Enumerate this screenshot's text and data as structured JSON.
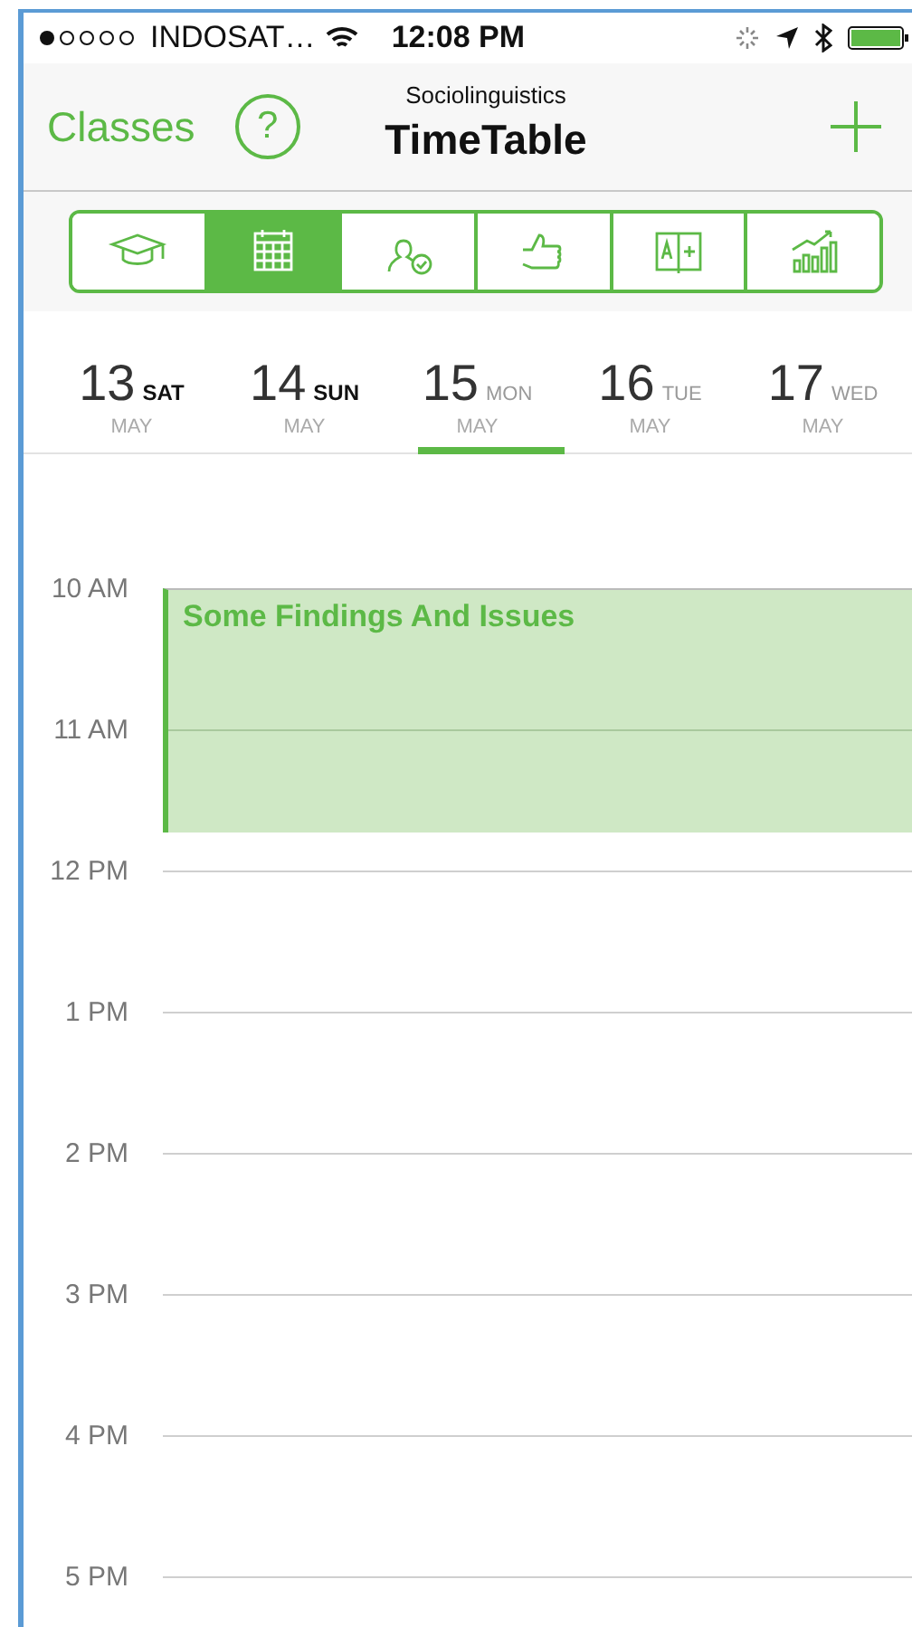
{
  "status_bar": {
    "carrier": "INDOSAT…",
    "time": "12:08 PM"
  },
  "nav": {
    "back": "Classes",
    "help": "?",
    "subtitle": "Sociolinguistics",
    "title": "TimeTable"
  },
  "segments": [
    {
      "kind": "cap",
      "selected": false
    },
    {
      "kind": "calendar",
      "selected": true
    },
    {
      "kind": "person",
      "selected": false
    },
    {
      "kind": "thumb",
      "selected": false
    },
    {
      "kind": "book",
      "selected": false
    },
    {
      "kind": "chart",
      "selected": false
    }
  ],
  "days": [
    {
      "day": "13",
      "weekday": "SAT",
      "month": "MAY",
      "weekend": true,
      "selected": false
    },
    {
      "day": "14",
      "weekday": "SUN",
      "month": "MAY",
      "weekend": true,
      "selected": false
    },
    {
      "day": "15",
      "weekday": "MON",
      "month": "MAY",
      "weekend": false,
      "selected": true
    },
    {
      "day": "16",
      "weekday": "TUE",
      "month": "MAY",
      "weekend": false,
      "selected": false
    },
    {
      "day": "17",
      "weekday": "WED",
      "month": "MAY",
      "weekend": false,
      "selected": false
    }
  ],
  "hours": [
    {
      "label": "10 AM",
      "event": {
        "title": "Some Findings And Issues"
      }
    },
    {
      "label": "11 AM"
    },
    {
      "label": "12 PM"
    },
    {
      "label": "1 PM"
    },
    {
      "label": "2 PM"
    },
    {
      "label": "3 PM"
    },
    {
      "label": "4 PM"
    },
    {
      "label": "5 PM"
    }
  ]
}
